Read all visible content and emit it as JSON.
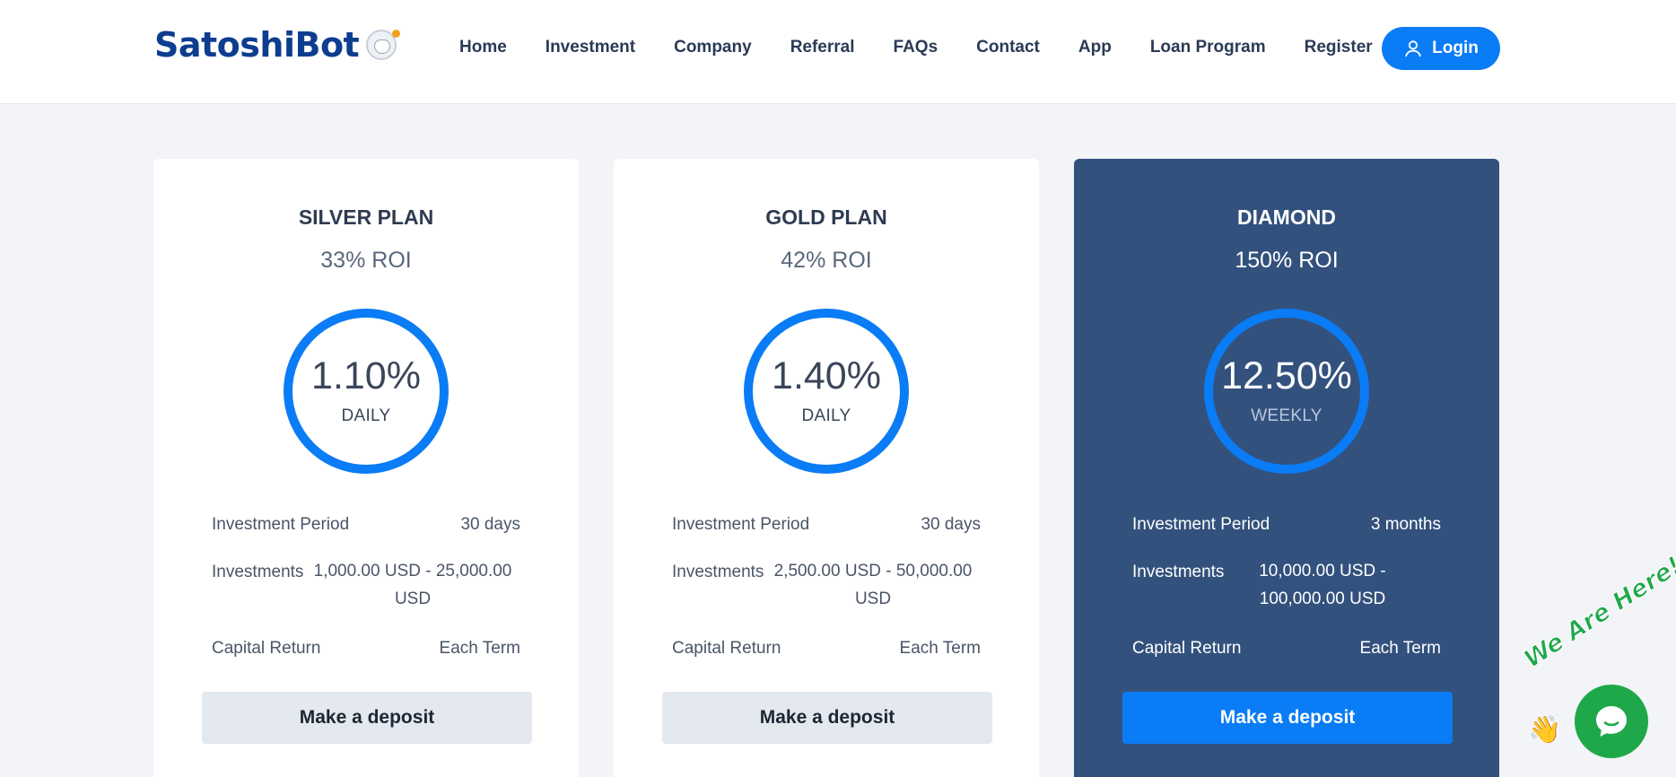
{
  "brand": {
    "name": "SatoshiBot",
    "mascot_icon": "anonymous-mask-mascot-icon"
  },
  "nav": {
    "items": [
      "Home",
      "Investment",
      "Company",
      "Referral",
      "FAQs",
      "Contact",
      "App",
      "Loan Program",
      "Register"
    ],
    "login_label": "Login"
  },
  "plans": [
    {
      "title": "SILVER PLAN",
      "roi": "33% ROI",
      "rate": "1.10%",
      "period": "DAILY",
      "investment_period_label": "Investment Period",
      "investment_period_value": "30 days",
      "investments_label": "Investments",
      "investments_range": "1,000.00 USD - 25,000.00 USD",
      "capital_return_label": "Capital Return",
      "capital_return_value": "Each Term",
      "cta": "Make a deposit",
      "highlighted": false
    },
    {
      "title": "GOLD PLAN",
      "roi": "42% ROI",
      "rate": "1.40%",
      "period": "DAILY",
      "investment_period_label": "Investment Period",
      "investment_period_value": "30 days",
      "investments_label": "Investments",
      "investments_range": "2,500.00 USD - 50,000.00 USD",
      "capital_return_label": "Capital Return",
      "capital_return_value": "Each Term",
      "cta": "Make a deposit",
      "highlighted": false
    },
    {
      "title": "DIAMOND",
      "roi": "150% ROI",
      "rate": "12.50%",
      "period": "WEEKLY",
      "investment_period_label": "Investment Period",
      "investment_period_value": "3 months",
      "investments_label": "Investments",
      "investments_range": "10,000.00 USD - 100,000.00 USD",
      "capital_return_label": "Capital Return",
      "capital_return_value": "Each Term",
      "cta": "Make a deposit",
      "highlighted": true
    }
  ],
  "chat": {
    "badge_text": "We Are Here!",
    "icon": "chat-bubble-icon"
  },
  "colors": {
    "accent": "#0a7cf5",
    "brand": "#0d3d8f",
    "highlight_card": "#33517d",
    "chat": "#1fa84a"
  }
}
